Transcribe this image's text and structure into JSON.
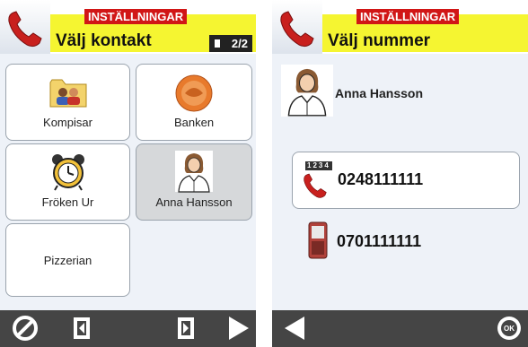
{
  "left": {
    "badge": "INSTÄLLNINGAR",
    "title": "Välj kontakt",
    "pager": "2/2",
    "tiles": [
      {
        "label": "Kompisar"
      },
      {
        "label": "Banken"
      },
      {
        "label": "Fröken Ur"
      },
      {
        "label": "Anna Hansson"
      },
      {
        "label": "Pizzerian"
      }
    ]
  },
  "right": {
    "badge": "INSTÄLLNINGAR",
    "title": "Välj nummer",
    "contact_name": "Anna Hansson",
    "numbers": [
      {
        "number": "0248111111",
        "type_tag": "1234"
      },
      {
        "number": "0701111111"
      }
    ]
  },
  "colors": {
    "header_band": "#f5f531",
    "badge": "#d11616",
    "bottombar": "#454545"
  }
}
